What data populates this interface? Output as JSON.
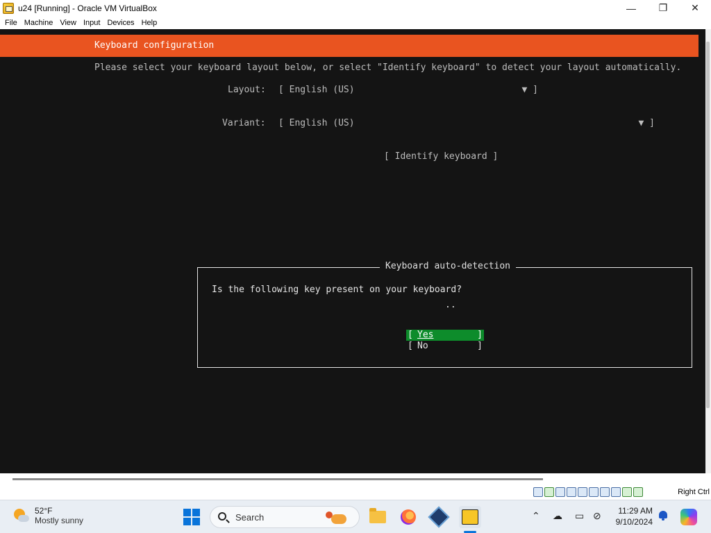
{
  "window": {
    "title": "u24 [Running] - Oracle VM VirtualBox",
    "controls": {
      "minimize": "—",
      "maximize": "❐",
      "close": "✕"
    }
  },
  "menu": [
    "File",
    "Machine",
    "View",
    "Input",
    "Devices",
    "Help"
  ],
  "installer": {
    "header": "Keyboard configuration",
    "instruction": "Please select your keyboard layout below, or select \"Identify keyboard\" to detect your layout automatically.",
    "layout_label": "Layout:",
    "layout_value": "[ English (US)",
    "layout_arrow": "▼ ]",
    "variant_label": "Variant:",
    "variant_value": "[ English (US)",
    "variant_arrow": "▼ ]",
    "identify_button": "[ Identify keyboard ]",
    "accent_color": "#e95420"
  },
  "dialog": {
    "title": "Keyboard auto-detection",
    "question": "Is the following key present on your keyboard?",
    "key": "..",
    "options": [
      {
        "label": "Yes",
        "selected": true,
        "color": "#0d8c2b"
      },
      {
        "label": "No",
        "selected": false
      }
    ]
  },
  "statusbar": {
    "host_key": "Right Ctrl",
    "icons": [
      "hdd-icon",
      "optical-icon",
      "usb-icon",
      "network-icon",
      "shared-folder-icon",
      "display-icon",
      "recording-icon",
      "cpu-icon",
      "mouse-integration-icon",
      "keyboard-icon"
    ]
  },
  "taskbar": {
    "weather_temp": "52°F",
    "weather_desc": "Mostly sunny",
    "search_placeholder": "Search",
    "apps": [
      "start-icon",
      "file-explorer-icon",
      "firefox-icon",
      "virtualbox-icon",
      "virtualbox-vm-icon"
    ],
    "time": "11:29 AM",
    "date": "9/10/2024"
  }
}
